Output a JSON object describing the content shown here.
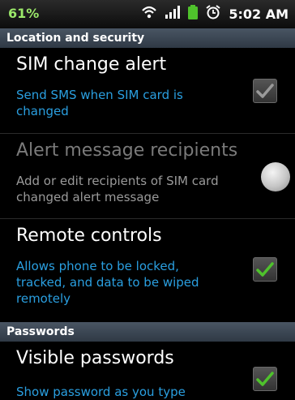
{
  "status_bar": {
    "left_label": "61%",
    "time": "5:02 AM",
    "icons": [
      "wifi-icon",
      "signal-icon",
      "battery-icon",
      "alarm-icon"
    ]
  },
  "sections": {
    "location": {
      "header": "Location and security"
    },
    "passwords": {
      "header": "Passwords"
    }
  },
  "items": {
    "sim_change": {
      "title": "SIM change alert",
      "summary": "Send SMS when SIM card is changed",
      "checked": true,
      "enabled": false
    },
    "alert_recipients": {
      "title": "Alert message recipients",
      "summary": "Add or edit recipients of SIM card changed alert message",
      "enabled": false
    },
    "remote_controls": {
      "title": "Remote controls",
      "summary": "Allows phone to be locked, tracked, and data to be wiped remotely",
      "checked": true
    },
    "visible_passwords": {
      "title": "Visible passwords",
      "summary": "Show password as you type",
      "checked": true
    }
  },
  "colors": {
    "summary_blue": "#2a9fe0",
    "check_green": "#4fc22c",
    "check_gray": "#9a9a9a"
  }
}
